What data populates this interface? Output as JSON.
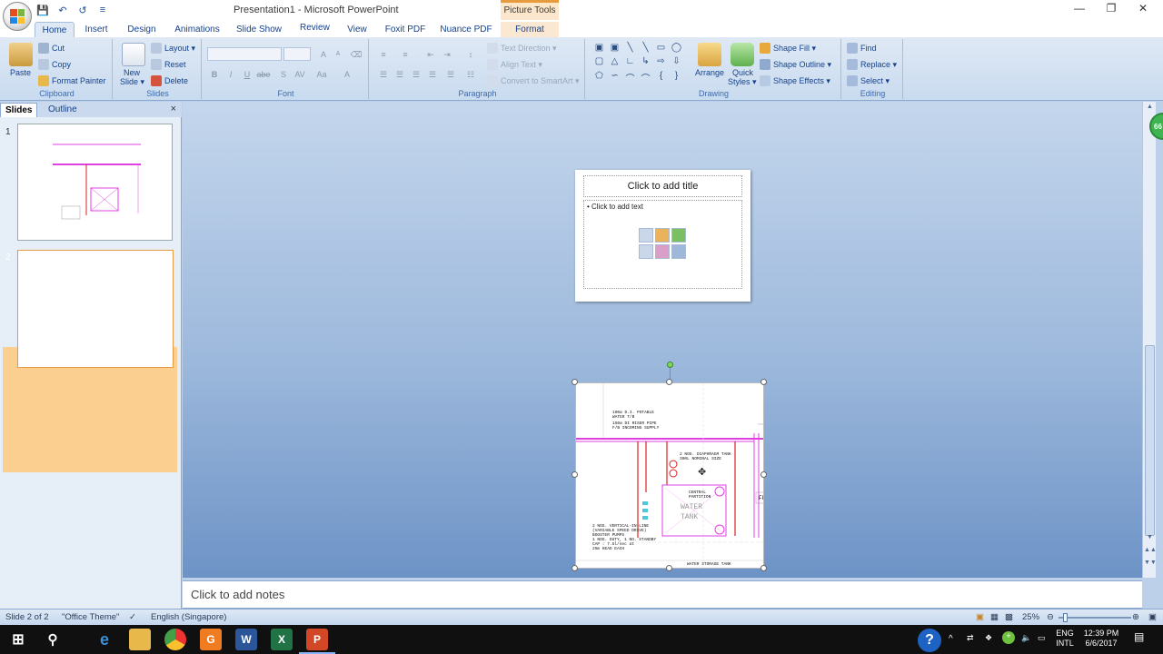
{
  "window": {
    "title": "Presentation1 - Microsoft PowerPoint",
    "context_group": "Picture Tools",
    "minimize": "—",
    "maximize": "❐",
    "close": "✕"
  },
  "quick_access": [
    "save-icon",
    "undo-icon",
    "redo-icon",
    "customize-icon"
  ],
  "tabs": [
    "Home",
    "Insert",
    "Design",
    "Animations",
    "Slide Show",
    "View",
    "Foxit PDF",
    "Nuance PDF",
    "Format"
  ],
  "ribbon": {
    "clipboard": {
      "label": "Clipboard",
      "paste": "Paste",
      "cut": "Cut",
      "copy": "Copy",
      "format_painter": "Format Painter"
    },
    "slides": {
      "label": "Slides",
      "new_slide": "New",
      "new_slide_2": "Slide ▾",
      "layout": "Layout ▾",
      "reset": "Reset",
      "delete": "Delete"
    },
    "font": {
      "label": "Font",
      "bold": "B",
      "italic": "I",
      "underline": "U",
      "strike": "abe",
      "shadow": "S",
      "spacing": "AV",
      "case": "Aa",
      "color": "A",
      "grow": "A",
      "shrink": "A"
    },
    "paragraph": {
      "label": "Paragraph",
      "text_direction": "Text Direction ▾",
      "align_text": "Align Text ▾",
      "convert_smartart": "Convert to SmartArt ▾"
    },
    "drawing": {
      "label": "Drawing",
      "arrange": "Arrange",
      "quick_styles": "Quick",
      "quick_styles_2": "Styles ▾",
      "shape_fill": "Shape Fill ▾",
      "shape_outline": "Shape Outline ▾",
      "shape_effects": "Shape Effects ▾"
    },
    "editing": {
      "label": "Editing",
      "find": "Find",
      "replace": "Replace ▾",
      "select": "Select ▾"
    }
  },
  "left_pane": {
    "tabs": [
      "Slides",
      "Outline"
    ],
    "close": "×",
    "slide_numbers": [
      "1",
      "2"
    ]
  },
  "slide": {
    "title_placeholder": "Click to add title",
    "body_placeholder": "• Click to add text"
  },
  "cad": {
    "note1": "100ø D.I. POTABLE\nWATER T/B",
    "note2": "150ø DI RISER PIPE\nF/B INCOMING SUPPLY",
    "note3": "2 NOS. DIAPHRAGM TANK\n300L NOMINAL SIZE",
    "note4": "CENTRAL\nPARTITION",
    "note5": "WATER\nTANK",
    "note6": "2 NOS. VERTICAL-IN-LINE\n(VARIABLE SPEED DRIVE)\nBOOSTER PUMPS\n1 NOS. DUTY, 1 NO. STANDBY\nCAP : 7.5l/sec at\n25m HEAD EACH",
    "note7": "WATER STORAGE TANK",
    "note8": "FF"
  },
  "badge": "66",
  "notes_placeholder": "Click to add notes",
  "status": {
    "slide_of": "Slide 2 of 2",
    "theme": "\"Office Theme\"",
    "language": "English (Singapore)",
    "zoom": "25%"
  },
  "tray": {
    "lang_1": "ENG",
    "lang_2": "INTL",
    "time": "12:39 PM",
    "date": "6/6/2017"
  },
  "taskbar_icons": [
    "windows-start-icon",
    "search-icon",
    "edge-icon",
    "file-explorer-icon",
    "chrome-icon",
    "foxit-icon",
    "word-icon",
    "excel-icon",
    "powerpoint-icon"
  ]
}
